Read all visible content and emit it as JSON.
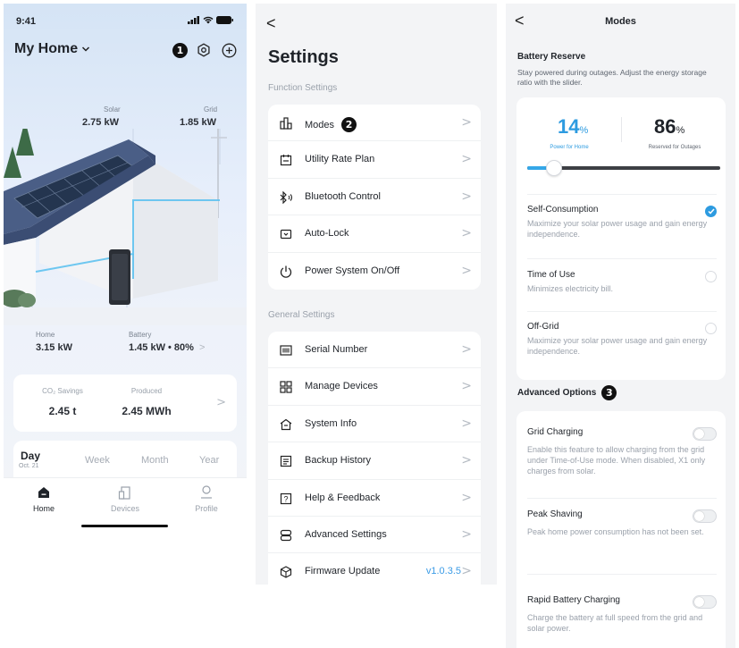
{
  "home": {
    "status_time": "9:41",
    "title": "My Home",
    "callout": "1",
    "solar": {
      "label": "Solar",
      "value": "2.75 kW"
    },
    "grid": {
      "label": "Grid",
      "value": "1.85 kW"
    },
    "home_flow": {
      "label": "Home",
      "value": "3.15 kW"
    },
    "battery": {
      "label": "Battery",
      "value": "1.45 kW • 80%",
      "chevron": ">"
    },
    "stats": {
      "co2_label": "CO₂ Savings",
      "co2_value": "2.45 t",
      "produced_label": "Produced",
      "produced_value": "2.45 MWh",
      "chevron": ">"
    },
    "periods": {
      "day": "Day",
      "date": "Oct. 21",
      "week": "Week",
      "month": "Month",
      "year": "Year"
    },
    "tabs": {
      "home": "Home",
      "devices": "Devices",
      "profile": "Profile"
    }
  },
  "settings": {
    "back": "<",
    "title": "Settings",
    "function_header": "Function Settings",
    "callout": "2",
    "function_items": [
      "Modes",
      "Utility Rate Plan",
      "Bluetooth Control",
      "Auto-Lock",
      "Power System On/Off"
    ],
    "general_header": "General Settings",
    "general_items": [
      "Serial Number",
      "Manage Devices",
      "System Info",
      "Backup History",
      "Help & Feedback",
      "Advanced Settings",
      "Firmware Update"
    ],
    "firmware_version": "v1.0.3.5",
    "chevron": ">"
  },
  "modes": {
    "back": "<",
    "title": "Modes",
    "battery_reserve": {
      "heading": "Battery Reserve",
      "description": "Stay powered during outages. Adjust the energy storage ratio with the slider.",
      "home_pct": "14",
      "home_label": "Power for Home",
      "reserved_pct": "86",
      "reserved_label": "Reserved for Outages",
      "pct_unit": "%",
      "slider_fraction": 0.14
    },
    "options": [
      {
        "title": "Self-Consumption",
        "desc": "Maximize your solar power usage and gain energy independence.",
        "selected": true
      },
      {
        "title": "Time of Use",
        "desc": "Minimizes electricity bill.",
        "selected": false
      },
      {
        "title": "Off-Grid",
        "desc": "Maximize your solar power usage and gain energy independence.",
        "selected": false
      }
    ],
    "advanced_heading": "Advanced Options",
    "callout": "3",
    "advanced": [
      {
        "title": "Grid Charging",
        "desc": "Enable this feature to allow charging from the grid under Time-of-Use mode. When disabled, X1 only charges from solar.",
        "on": false
      },
      {
        "title": "Peak Shaving",
        "desc": "Peak home power consumption has not been set.",
        "on": false
      },
      {
        "title": "Rapid Battery Charging",
        "desc": "Charge the battery at full speed from the grid and solar power.",
        "on": false
      }
    ]
  },
  "colors": {
    "accent": "#2d9be0",
    "slider_fill": "#35a7e8",
    "version": "#3a9be6"
  }
}
